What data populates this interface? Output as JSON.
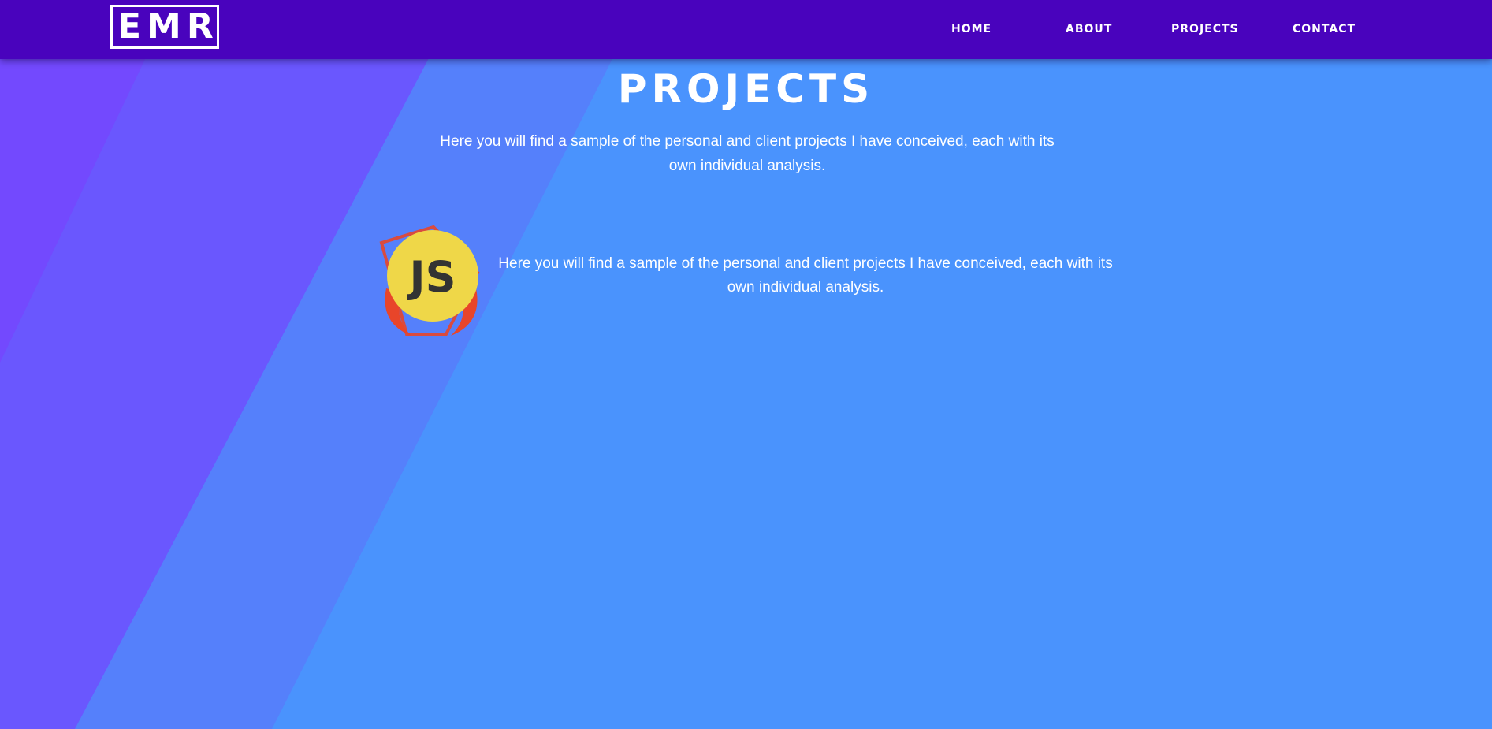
{
  "nav": {
    "logo": "EMR",
    "links": [
      "HOME",
      "ABOUT",
      "PROJECTS",
      "CONTACT"
    ]
  },
  "main": {
    "title": "PROJECTS",
    "intro": "Here you will find a sample of the personal and client projects I have conceived, each with its own individual analysis."
  },
  "projects": [
    {
      "icon": "javascript-logo-icon",
      "logo_text": "JS",
      "description": "Here you will find a sample of the personal and client projects I have conceived, each with its own individual analysis."
    }
  ],
  "colors": {
    "navbar": "#4903bd",
    "background_light": "#4a93fd",
    "background_mid": "#5580fb",
    "background_dark": "#6a57fe",
    "js_yellow": "#efd748",
    "js_red": "#e8452a",
    "text": "#ffffff"
  }
}
